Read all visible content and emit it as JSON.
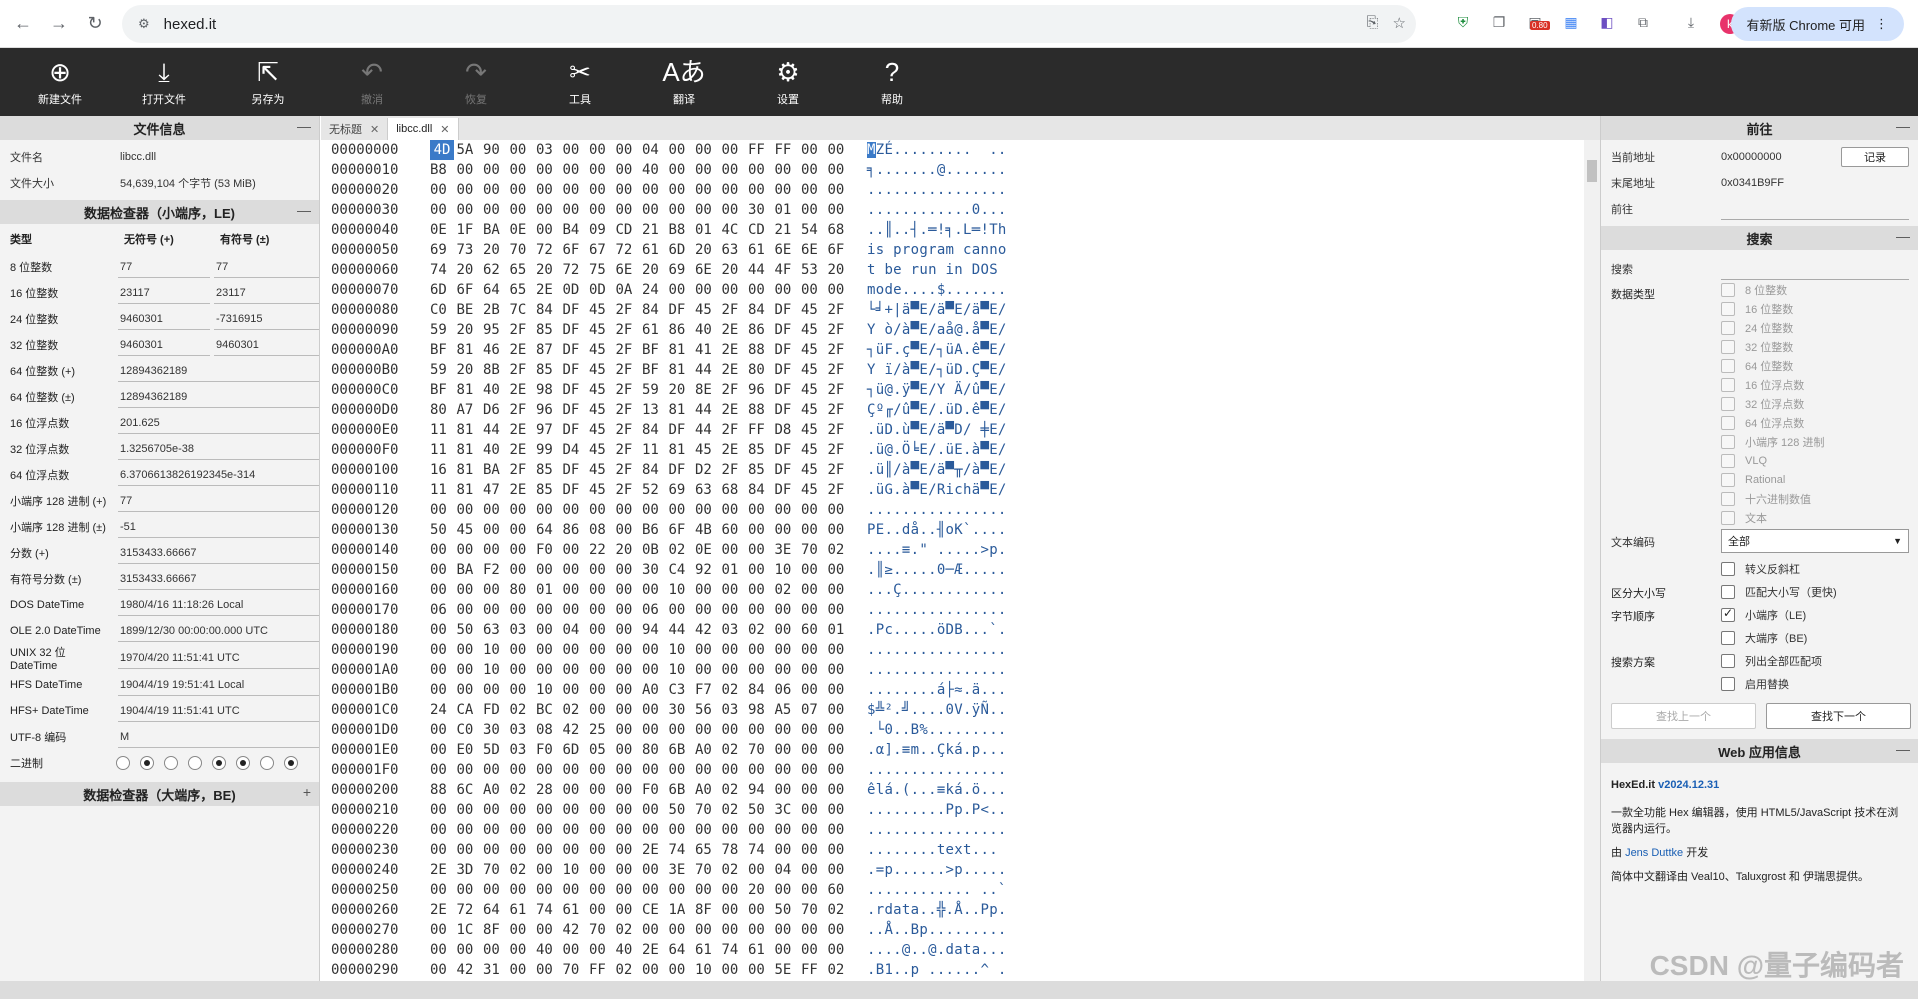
{
  "browser": {
    "url": "hexed.it",
    "update_label": "有新版 Chrome 可用",
    "avatar_letter": "k",
    "ext_badge": "0.80"
  },
  "toolbar": {
    "new_file": "新建文件",
    "open_file": "打开文件",
    "save_as": "另存为",
    "undo": "撤消",
    "redo": "恢复",
    "tools": "工具",
    "translate": "翻译",
    "settings": "设置",
    "help": "帮助"
  },
  "file_info": {
    "title": "文件信息",
    "name_label": "文件名",
    "name_value": "libcc.dll",
    "size_label": "文件大小",
    "size_value": "54,639,104 个字节 (53 MiB)"
  },
  "inspector_le": {
    "title": "数据检查器（小端序，LE)",
    "col_type": "类型",
    "col_unsigned": "无符号 (+)",
    "col_signed": "有符号 (±)",
    "rows": [
      {
        "label": "8 位整数",
        "u": "77",
        "s": "77"
      },
      {
        "label": "16 位整数",
        "u": "23117",
        "s": "23117"
      },
      {
        "label": "24 位整数",
        "u": "9460301",
        "s": "-7316915"
      },
      {
        "label": "32 位整数",
        "u": "9460301",
        "s": "9460301"
      }
    ],
    "wide_rows": [
      {
        "label": "64 位整数 (+)",
        "v": "12894362189"
      },
      {
        "label": "64 位整数 (±)",
        "v": "12894362189"
      },
      {
        "label": "16 位浮点数",
        "v": "201.625"
      },
      {
        "label": "32 位浮点数",
        "v": "1.3256705e-38"
      },
      {
        "label": "64 位浮点数",
        "v": "6.3706613826192345e-314"
      },
      {
        "label": "小端序 128 进制 (+)",
        "v": "77"
      },
      {
        "label": "小端序 128 进制 (±)",
        "v": "-51"
      },
      {
        "label": "分数 (+)",
        "v": "3153433.66667"
      },
      {
        "label": "有符号分数 (±)",
        "v": "3153433.66667"
      },
      {
        "label": "DOS DateTime",
        "v": "1980/4/16 11:18:26 Local"
      },
      {
        "label": "OLE 2.0 DateTime",
        "v": "1899/12/30 00:00:00.000 UTC"
      },
      {
        "label": "UNIX 32 位 DateTime",
        "v": "1970/4/20 11:51:41 UTC"
      },
      {
        "label": "HFS DateTime",
        "v": "1904/4/19 19:51:41 Local"
      },
      {
        "label": "HFS+ DateTime",
        "v": "1904/4/19 11:51:41 UTC"
      },
      {
        "label": "UTF-8 编码",
        "v": "M"
      }
    ],
    "binary_label": "二进制",
    "binary_bits": [
      0,
      1,
      0,
      0,
      1,
      1,
      0,
      1
    ]
  },
  "inspector_be": {
    "title": "数据检查器（大端序，BE)"
  },
  "tabs": [
    {
      "label": "无标题",
      "active": false
    },
    {
      "label": "libcc.dll",
      "active": true
    }
  ],
  "hex_rows": [
    {
      "o": "00000000",
      "b": "4D 5A 90 00 03 00 00 00 04 00 00 00 FF FF 00 00",
      "a": "MZÉ.........  .."
    },
    {
      "o": "00000010",
      "b": "B8 00 00 00 00 00 00 00 40 00 00 00 00 00 00 00",
      "a": "╕.......@......."
    },
    {
      "o": "00000020",
      "b": "00 00 00 00 00 00 00 00 00 00 00 00 00 00 00 00",
      "a": "................"
    },
    {
      "o": "00000030",
      "b": "00 00 00 00 00 00 00 00 00 00 00 00 30 01 00 00",
      "a": "............0..."
    },
    {
      "o": "00000040",
      "b": "0E 1F BA 0E 00 B4 09 CD 21 B8 01 4C CD 21 54 68",
      "a": "..║..┤.═!╕.L═!Th"
    },
    {
      "o": "00000050",
      "b": "69 73 20 70 72 6F 67 72 61 6D 20 63 61 6E 6E 6F",
      "a": "is program canno"
    },
    {
      "o": "00000060",
      "b": "74 20 62 65 20 72 75 6E 20 69 6E 20 44 4F 53 20",
      "a": "t be run in DOS "
    },
    {
      "o": "00000070",
      "b": "6D 6F 64 65 2E 0D 0D 0A 24 00 00 00 00 00 00 00",
      "a": "mode....$......."
    },
    {
      "o": "00000080",
      "b": "C0 BE 2B 7C 84 DF 45 2F 84 DF 45 2F 84 DF 45 2F",
      "a": "└╛+|ä▀E/ä▀E/ä▀E/"
    },
    {
      "o": "00000090",
      "b": "59 20 95 2F 85 DF 45 2F 61 86 40 2E 86 DF 45 2F",
      "a": "Y ò/à▀E/aå@.å▀E/"
    },
    {
      "o": "000000A0",
      "b": "BF 81 46 2E 87 DF 45 2F BF 81 41 2E 88 DF 45 2F",
      "a": "┐üF.ç▀E/┐üA.ê▀E/"
    },
    {
      "o": "000000B0",
      "b": "59 20 8B 2F 85 DF 45 2F BF 81 44 2E 80 DF 45 2F",
      "a": "Y ï/à▀E/┐üD.Ç▀E/"
    },
    {
      "o": "000000C0",
      "b": "BF 81 40 2E 98 DF 45 2F 59 20 8E 2F 96 DF 45 2F",
      "a": "┐ü@.ÿ▀E/Y Ä/û▀E/"
    },
    {
      "o": "000000D0",
      "b": "80 A7 D6 2F 96 DF 45 2F 13 81 44 2E 88 DF 45 2F",
      "a": "Çº╓/û▀E/.üD.ê▀E/"
    },
    {
      "o": "000000E0",
      "b": "11 81 44 2E 97 DF 45 2F 84 DF 44 2F FF D8 45 2F",
      "a": ".üD.ù▀E/ä▀D/ ╪E/"
    },
    {
      "o": "000000F0",
      "b": "11 81 40 2E 99 D4 45 2F 11 81 45 2E 85 DF 45 2F",
      "a": ".ü@.Ö╘E/.üE.à▀E/"
    },
    {
      "o": "00000100",
      "b": "16 81 BA 2F 85 DF 45 2F 84 DF D2 2F 85 DF 45 2F",
      "a": ".ü║/à▀E/ä▀╥/à▀E/"
    },
    {
      "o": "00000110",
      "b": "11 81 47 2E 85 DF 45 2F 52 69 63 68 84 DF 45 2F",
      "a": ".üG.à▀E/Richä▀E/"
    },
    {
      "o": "00000120",
      "b": "00 00 00 00 00 00 00 00 00 00 00 00 00 00 00 00",
      "a": "................"
    },
    {
      "o": "00000130",
      "b": "50 45 00 00 64 86 08 00 B6 6F 4B 60 00 00 00 00",
      "a": "PE..då..╢oK`...."
    },
    {
      "o": "00000140",
      "b": "00 00 00 00 F0 00 22 20 0B 02 0E 00 00 3E 70 02",
      "a": "....≡.\" .....>p."
    },
    {
      "o": "00000150",
      "b": "00 BA F2 00 00 00 00 00 30 C4 92 01 00 10 00 00",
      "a": ".║≥.....0─Æ....."
    },
    {
      "o": "00000160",
      "b": "00 00 00 80 01 00 00 00 00 10 00 00 00 02 00 00",
      "a": "...Ç............"
    },
    {
      "o": "00000170",
      "b": "06 00 00 00 00 00 00 00 06 00 00 00 00 00 00 00",
      "a": "................"
    },
    {
      "o": "00000180",
      "b": "00 50 63 03 00 04 00 00 94 44 42 03 02 00 60 01",
      "a": ".Pc.....öDB...`."
    },
    {
      "o": "00000190",
      "b": "00 00 10 00 00 00 00 00 00 10 00 00 00 00 00 00",
      "a": "................"
    },
    {
      "o": "000001A0",
      "b": "00 00 10 00 00 00 00 00 00 10 00 00 00 00 00 00",
      "a": "................"
    },
    {
      "o": "000001B0",
      "b": "00 00 00 00 10 00 00 00 A0 C3 F7 02 84 06 00 00",
      "a": "........á├≈.ä..."
    },
    {
      "o": "000001C0",
      "b": "24 CA FD 02 BC 02 00 00 00 30 56 03 98 A5 07 00",
      "a": "$╩².╝....0V.ÿÑ.."
    },
    {
      "o": "000001D0",
      "b": "00 C0 30 03 08 42 25 00 00 00 00 00 00 00 00 00",
      "a": ".└0..B%........."
    },
    {
      "o": "000001E0",
      "b": "00 E0 5D 03 F0 6D 05 00 80 6B A0 02 70 00 00 00",
      "a": ".α].≡m..Çká.p..."
    },
    {
      "o": "000001F0",
      "b": "00 00 00 00 00 00 00 00 00 00 00 00 00 00 00 00",
      "a": "................"
    },
    {
      "o": "00000200",
      "b": "88 6C A0 02 28 00 00 00 F0 6B A0 02 94 00 00 00",
      "a": "êlá.(...≡ká.ö..."
    },
    {
      "o": "00000210",
      "b": "00 00 00 00 00 00 00 00 00 50 70 02 50 3C 00 00",
      "a": ".........Pp.P<.."
    },
    {
      "o": "00000220",
      "b": "00 00 00 00 00 00 00 00 00 00 00 00 00 00 00 00",
      "a": "................"
    },
    {
      "o": "00000230",
      "b": "00 00 00 00 00 00 00 00 2E 74 65 78 74 00 00 00",
      "a": "........text..."
    },
    {
      "o": "00000240",
      "b": "2E 3D 70 02 00 10 00 00 00 3E 70 02 00 04 00 00",
      "a": ".=p......>p....."
    },
    {
      "o": "00000250",
      "b": "00 00 00 00 00 00 00 00 00 00 00 00 20 00 00 60",
      "a": "............ ..`"
    },
    {
      "o": "00000260",
      "b": "2E 72 64 61 74 61 00 00 CE 1A 8F 00 00 50 70 02",
      "a": ".rdata..╬.Å..Pp."
    },
    {
      "o": "00000270",
      "b": "00 1C 8F 00 00 42 70 02 00 00 00 00 00 00 00 00",
      "a": "..Å..Bp........."
    },
    {
      "o": "00000280",
      "b": "00 00 00 00 40 00 00 40 2E 64 61 74 61 00 00 00",
      "a": "....@..@.data..."
    },
    {
      "o": "00000290",
      "b": "00 42 31 00 00 70 FF 02 00 00 10 00 00 5E FF 02",
      "a": ".B1..p ......^ ."
    }
  ],
  "goto": {
    "title": "前往",
    "current_label": "当前地址",
    "current_value": "0x00000000",
    "record_button": "记录",
    "end_label": "末尾地址",
    "end_value": "0x0341B9FF",
    "goto_label": "前往"
  },
  "search": {
    "title": "搜索",
    "search_label": "搜索",
    "datatype_label": "数据类型",
    "types": [
      "8 位整数",
      "16 位整数",
      "24 位整数",
      "32 位整数",
      "64 位整数",
      "16 位浮点数",
      "32 位浮点数",
      "64 位浮点数",
      "小端序 128 进制",
      "VLQ",
      "Rational",
      "十六进制数值",
      "文本"
    ],
    "encoding_label": "文本编码",
    "encoding_value": "全部",
    "escape_label": "转义反斜杠",
    "case_label": "区分大小写",
    "case_option": "匹配大小写（更快)",
    "byteorder_label": "字节顺序",
    "le_option": "小端序（LE)",
    "be_option": "大端序（BE)",
    "scheme_label": "搜索方案",
    "list_all": "列出全部匹配项",
    "enable_replace": "启用替换",
    "find_prev": "查找上一个",
    "find_next": "查找下一个"
  },
  "webinfo": {
    "title": "Web 应用信息",
    "app_name": "HexEd.it",
    "version": "v2024.12.31",
    "desc": "一款全功能 Hex 编辑器，使用 HTML5/JavaScript 技术在浏览器内运行。",
    "by_prefix": "由",
    "author": "Jens Duttke",
    "by_suffix": "开发",
    "footer": "简体中文翻译由 Veal10、Taluxgrost 和 伊瑞思提供。"
  },
  "watermark": "CSDN @量子编码者"
}
